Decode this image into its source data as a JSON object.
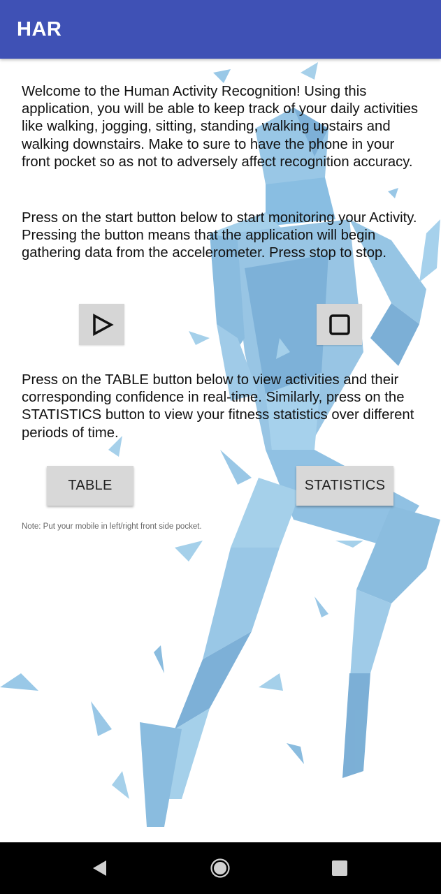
{
  "app_bar": {
    "title": "HAR",
    "color": "#3f51b5"
  },
  "intro": {
    "welcome": "Welcome to the Human Activity Recognition! Using this application, you will be able to keep track of your daily activities like walking, jogging, sitting, standing, walking upstairs and walking downstairs. Make to sure to have the phone in your front pocket so as not to adversely affect recognition accuracy.",
    "monitor": "Press on the start button below to start monitoring your Activity. Pressing the button means that the application will begin gathering data from the accelerometer. Press stop to stop.",
    "table_info": "Press on the TABLE button below to view activities and their corresponding confidence in real-time. Similarly, press on the STATISTICS button to view your fitness statistics over different periods of time."
  },
  "controls": {
    "start_icon": "play-icon",
    "stop_icon": "stop-icon",
    "table_label": "TABLE",
    "statistics_label": "STATISTICS"
  },
  "note": "Note: Put your mobile in left/right front side pocket.",
  "nav": {
    "back_icon": "back-triangle-icon",
    "home_icon": "home-circle-icon",
    "recent_icon": "recent-square-icon"
  },
  "colors": {
    "accent": "#3f51b5",
    "art": "#7fb6dc",
    "button": "#d6d6d6"
  }
}
